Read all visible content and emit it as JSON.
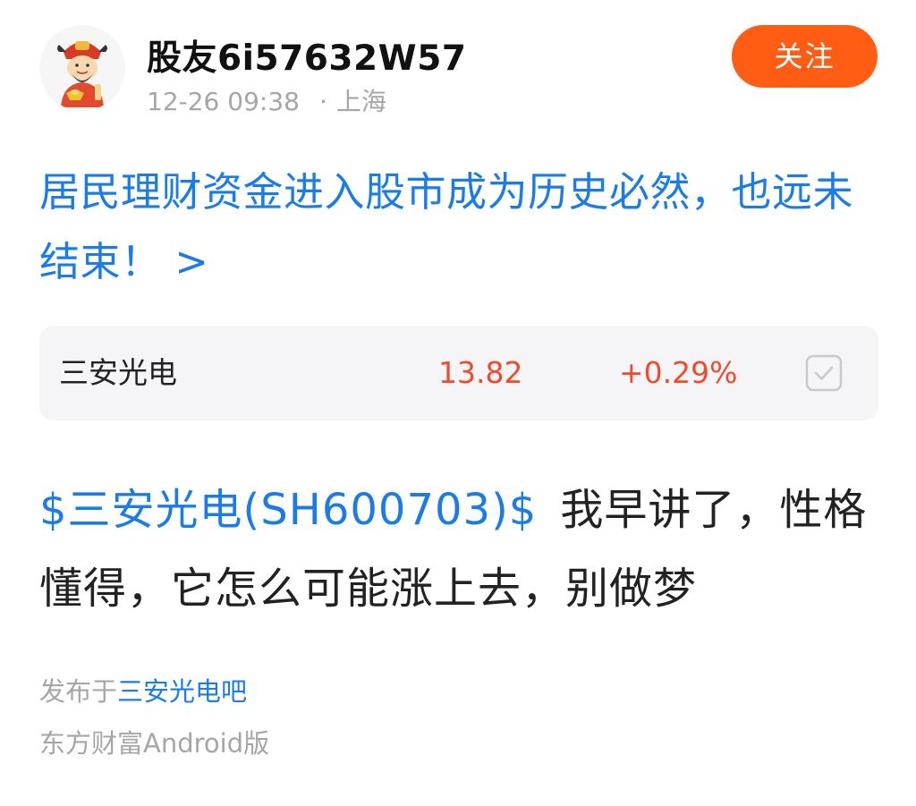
{
  "post": {
    "author": {
      "name": "股友6i57632W57",
      "time": "12-26 09:38",
      "separator": "·",
      "location": "上海",
      "avatar_icon": "fortune-god-avatar"
    },
    "follow_label": "关注",
    "title": "居民理财资金进入股市成为历史必然，也远未结束！ >",
    "stock": {
      "name": "三安光电",
      "price": "13.82",
      "change": "+0.29%",
      "price_color": "#f0492c",
      "icon": "check-square-icon"
    },
    "body": {
      "stock_tag": "$三安光电(SH600703)$",
      "text": "我早讲了，性格懂得，它怎么可能涨上去，别做梦"
    },
    "published_prefix": "发布于",
    "forum": "三安光电吧",
    "client": "东方财富Android版"
  },
  "colors": {
    "accent_blue": "#1b7ce8",
    "follow_orange": "#fe5d13",
    "up_red": "#f0492c",
    "meta_gray": "#a6a6a6"
  }
}
